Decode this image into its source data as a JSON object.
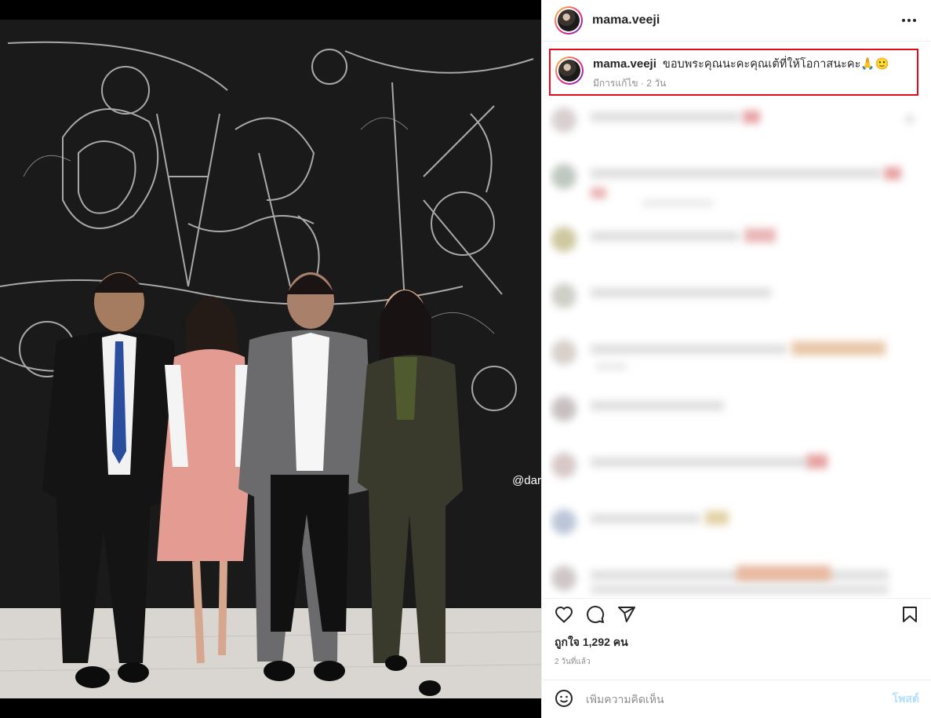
{
  "post": {
    "username": "mama.veeji",
    "watermark": "@dar"
  },
  "caption": {
    "username": "mama.veeji",
    "text": "ขอบพระคุณนะคะคุณเต้ที่ให้โอกาสนะคะ🙏🙂",
    "meta": "มีการแก้ไข · 2 วัน"
  },
  "stats": {
    "likes": "ถูกใจ 1,292 คน",
    "time": "2 วันที่แล้ว"
  },
  "composer": {
    "placeholder": "เพิ่มความคิดเห็น",
    "post_label": "โพสต์"
  },
  "icons": {
    "more": "more-options-icon",
    "like": "heart-icon",
    "comment": "comment-icon",
    "share": "share-icon",
    "save": "bookmark-icon",
    "emoji": "emoji-icon"
  },
  "colors": {
    "highlight_border": "#e00b1c",
    "text": "#262626",
    "muted": "#8e8e8e",
    "post_button": "#b2dffc"
  }
}
